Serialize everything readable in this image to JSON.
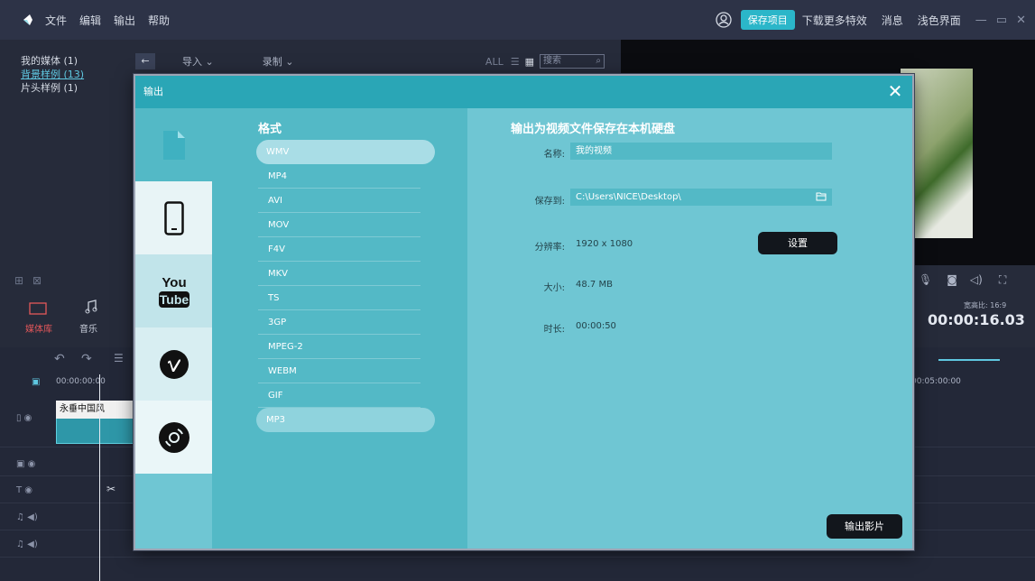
{
  "menubar": {
    "items": [
      "文件",
      "编辑",
      "输出",
      "帮助"
    ],
    "save_project": "保存项目",
    "download_effects": "下载更多特效",
    "messages": "消息",
    "theme": "浅色界面"
  },
  "media": {
    "nav": [
      "我的媒体 (1)",
      "背景样例 (13)",
      "片头样例 (1)"
    ],
    "import_label": "导入",
    "record_label": "录制",
    "all_label": "ALL",
    "search_placeholder": "搜索"
  },
  "bottom_tabs": {
    "library": "媒体库",
    "music": "音乐"
  },
  "preview": {
    "timecode": "00:00:16.03",
    "ratio": "宽高比: 16:9"
  },
  "timeline": {
    "start_time": "00:00:00:00",
    "end_time": "00:05:00:00",
    "clip_label": "永垂中国风"
  },
  "dialog": {
    "title": "输出",
    "close": "✕",
    "format_heading": "格式",
    "formats": [
      "WMV",
      "MP4",
      "AVI",
      "MOV",
      "F4V",
      "MKV",
      "TS",
      "3GP",
      "MPEG-2",
      "WEBM",
      "GIF",
      "MP3"
    ],
    "selected_format": "WMV",
    "settings_heading": "输出为视频文件保存在本机硬盘",
    "name_label": "名称:",
    "name_value": "我的视频",
    "save_to_label": "保存到:",
    "save_to_value": "C:\\Users\\NICE\\Desktop\\",
    "resolution_label": "分辨率:",
    "resolution_value": "1920 x 1080",
    "settings_button": "设置",
    "size_label": "大小:",
    "size_value": "48.7 MB",
    "duration_label": "时长:",
    "duration_value": "00:00:50",
    "export_button": "输出影片",
    "destinations": [
      "local-file-icon",
      "mobile-device-icon",
      "youtube-icon",
      "vimeo-icon",
      "disc-icon"
    ]
  },
  "colors": {
    "accent": "#2bb6c9",
    "dialog_bg": "#6fc6d3",
    "format_col": "#53b9c6",
    "title_bar": "#2aa6b6",
    "dark_button": "#12161c"
  }
}
